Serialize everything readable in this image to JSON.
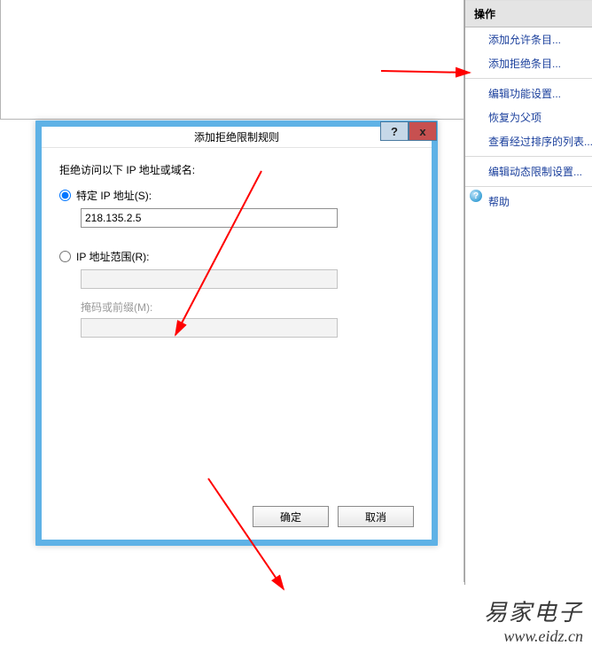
{
  "right_panel": {
    "header": "操作",
    "items": [
      {
        "label": "添加允许条目...",
        "icon": null
      },
      {
        "label": "添加拒绝条目...",
        "icon": null
      },
      {
        "label": "编辑功能设置...",
        "icon": null
      },
      {
        "label": "恢复为父项",
        "icon": null
      },
      {
        "label": "查看经过排序的列表...",
        "icon": null
      },
      {
        "label": "编辑动态限制设置...",
        "icon": null
      },
      {
        "label": "帮助",
        "icon": "help"
      }
    ]
  },
  "dialog": {
    "title": "添加拒绝限制规则",
    "help_glyph": "?",
    "close_glyph": "x",
    "section_title": "拒绝访问以下 IP 地址或域名:",
    "radio_specific": "特定 IP 地址(S):",
    "specific_value": "218.135.2.5",
    "radio_range": "IP 地址范围(R):",
    "range_value": "",
    "mask_label": "掩码或前缀(M):",
    "mask_value": "",
    "ok": "确定",
    "cancel": "取消"
  },
  "watermark": {
    "cn": "易家电子",
    "en": "www.eidz.cn"
  }
}
